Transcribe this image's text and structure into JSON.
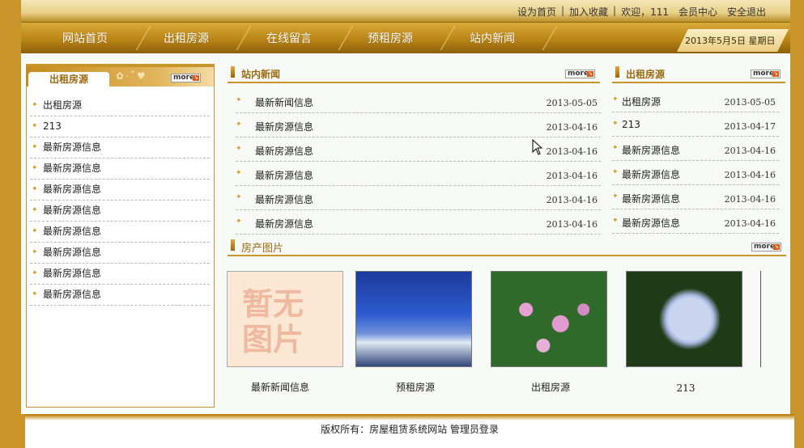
{
  "toplinks": [
    "设为首页",
    "加入收藏",
    "欢迎，111",
    "会员中心",
    "安全退出"
  ],
  "nav": [
    "网站首页",
    "出租房源",
    "在线留言",
    "预租房源",
    "站内新闻"
  ],
  "date": "2013年5月5日  星期日",
  "more_label": "more",
  "left": {
    "title": "出租房源",
    "items": [
      "出租房源",
      "213",
      "最新房源信息",
      "最新房源信息",
      "最新房源信息",
      "最新房源信息",
      "最新房源信息",
      "最新房源信息",
      "最新房源信息",
      "最新房源信息"
    ]
  },
  "news": {
    "title": "站内新闻",
    "rows": [
      {
        "title": "最新新闻信息",
        "date": "2013-05-05"
      },
      {
        "title": "最新房源信息",
        "date": "2013-04-16"
      },
      {
        "title": "最新房源信息",
        "date": "2013-04-16"
      },
      {
        "title": "最新房源信息",
        "date": "2013-04-16"
      },
      {
        "title": "最新房源信息",
        "date": "2013-04-16"
      },
      {
        "title": "最新房源信息",
        "date": "2013-04-16"
      }
    ]
  },
  "rent": {
    "title": "出租房源",
    "rows": [
      {
        "title": "出租房源",
        "date": "2013-05-05"
      },
      {
        "title": "213",
        "date": "2013-04-17"
      },
      {
        "title": "最新房源信息",
        "date": "2013-04-16"
      },
      {
        "title": "最新房源信息",
        "date": "2013-04-16"
      },
      {
        "title": "最新房源信息",
        "date": "2013-04-16"
      },
      {
        "title": "最新房源信息",
        "date": "2013-04-16"
      }
    ]
  },
  "photos": {
    "title": "房产图片",
    "noimage_text": [
      "暂无",
      "图片"
    ],
    "captions": [
      "最新新闻信息",
      "预租房源",
      "出租房源",
      "213"
    ]
  },
  "footer": "版权所有：房屋租赁系统网站  管理员登录",
  "colors": {
    "accent": "#c9952a",
    "title": "#9b6a10"
  }
}
